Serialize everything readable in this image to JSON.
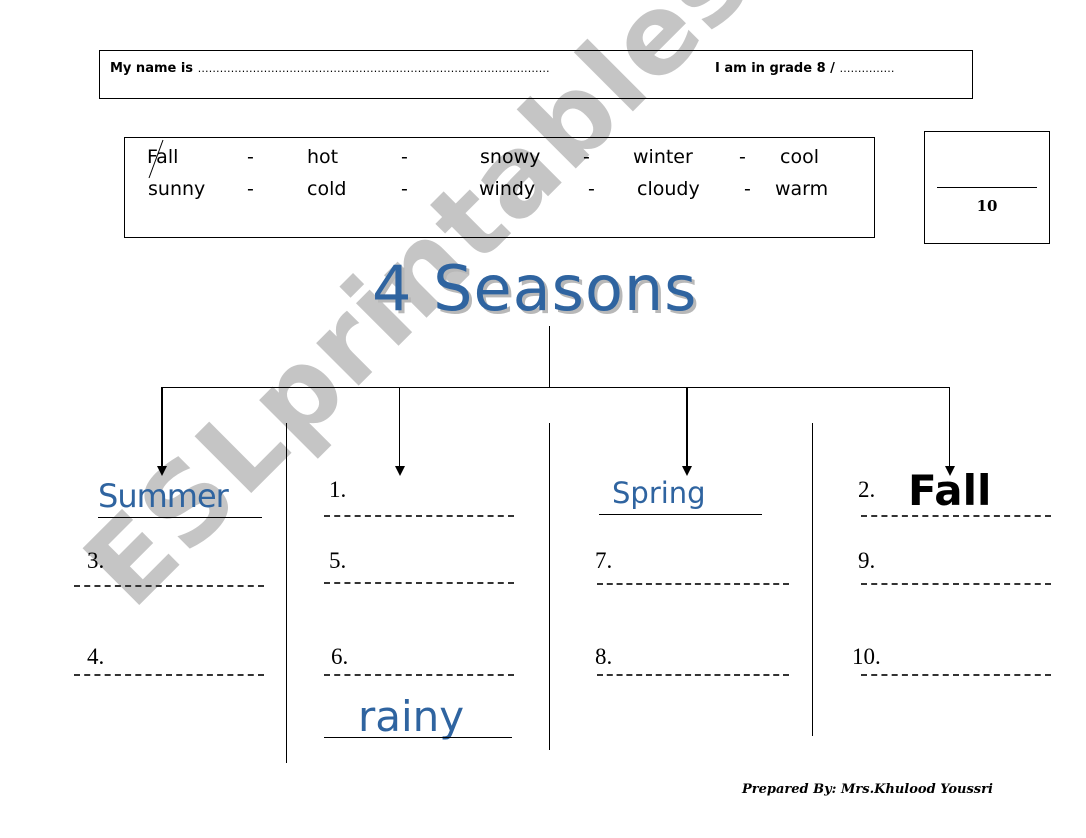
{
  "header": {
    "name_label": "My name is",
    "name_dots": "……………………………………………………………………………………",
    "grade_label": "I am in grade 8 /",
    "grade_dots": "……………"
  },
  "word_bank": {
    "row1": [
      "Fall",
      "hot",
      "snowy",
      "winter",
      "cool"
    ],
    "row2": [
      "sunny",
      "cold",
      "windy",
      "cloudy",
      "warm"
    ],
    "separator": "-",
    "crossed_out": "Fall"
  },
  "score": {
    "total": "10"
  },
  "title": "4 Seasons",
  "columns": [
    {
      "heading": "Summer",
      "items": [
        {
          "number": "3.",
          "answer": ""
        },
        {
          "number": "4.",
          "answer": ""
        }
      ]
    },
    {
      "heading_number": "1.",
      "items": [
        {
          "number": "5.",
          "answer": ""
        },
        {
          "number": "6.",
          "answer": ""
        }
      ],
      "example_answer": "rainy"
    },
    {
      "heading": "Spring",
      "items": [
        {
          "number": "7.",
          "answer": ""
        },
        {
          "number": "8.",
          "answer": ""
        }
      ]
    },
    {
      "heading_number": "2.",
      "heading_answer": "Fall",
      "items": [
        {
          "number": "9.",
          "answer": ""
        },
        {
          "number": "10.",
          "answer": ""
        }
      ]
    }
  ],
  "credit": "Prepared By: Mrs.Khulood Youssri",
  "watermark": "ESLprintables.com",
  "colors": {
    "title_blue": "#2f64a0",
    "watermark_gray": "#969696"
  }
}
